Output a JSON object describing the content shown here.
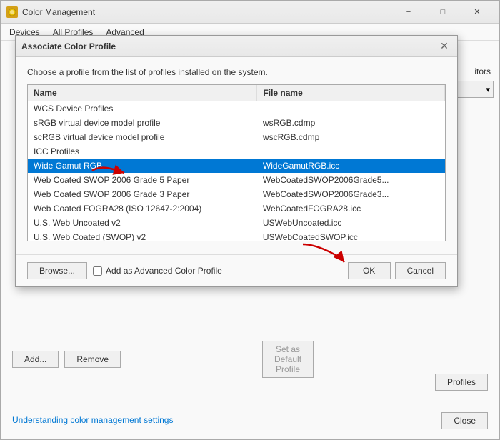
{
  "mainWindow": {
    "title": "Color Management",
    "menuItems": [
      "Devices",
      "All Profiles",
      "Advanced"
    ],
    "link": "Understanding color management settings",
    "closeBtn": "Close",
    "addBtn": "Add...",
    "removeBtn": "Remove",
    "setDefaultBtn": "Set as Default Profile",
    "profilesBtn": "Profiles",
    "dropdownArrow": "▾",
    "monitorsLabel": "itors"
  },
  "dialog": {
    "title": "Associate Color Profile",
    "description": "Choose a profile from the list of profiles installed on the system.",
    "closeBtn": "✕",
    "columns": [
      "Name",
      "File name"
    ],
    "rows": [
      {
        "type": "category",
        "name": "WCS Device Profiles",
        "filename": ""
      },
      {
        "type": "item",
        "name": "sRGB virtual device model profile",
        "filename": "wsRGB.cdmp"
      },
      {
        "type": "item",
        "name": "scRGB virtual device model profile",
        "filename": "wscRGB.cdmp"
      },
      {
        "type": "category",
        "name": "ICC Profiles",
        "filename": ""
      },
      {
        "type": "item",
        "name": "Wide Gamut RGB",
        "filename": "WideGamutRGB.icc",
        "selected": true
      },
      {
        "type": "item",
        "name": "Web Coated SWOP 2006 Grade 5 Paper",
        "filename": "WebCoatedSWOP2006Grade5..."
      },
      {
        "type": "item",
        "name": "Web Coated SWOP 2006 Grade 3 Paper",
        "filename": "WebCoatedSWOP2006Grade3..."
      },
      {
        "type": "item",
        "name": "Web Coated FOGRA28 (ISO 12647-2:2004)",
        "filename": "WebCoatedFOGRA28.icc"
      },
      {
        "type": "item",
        "name": "U.S. Web Uncoated v2",
        "filename": "USWebUncoated.icc"
      },
      {
        "type": "item",
        "name": "U.S. Web Coated (SWOP) v2",
        "filename": "USWebCoatedSWOP.icc"
      }
    ],
    "browseBtn": "Browse...",
    "checkboxLabel": "Add as Advanced Color Profile",
    "okBtn": "OK",
    "cancelBtn": "Cancel"
  },
  "arrows": {
    "arrow1": "→",
    "arrow2": "→"
  }
}
